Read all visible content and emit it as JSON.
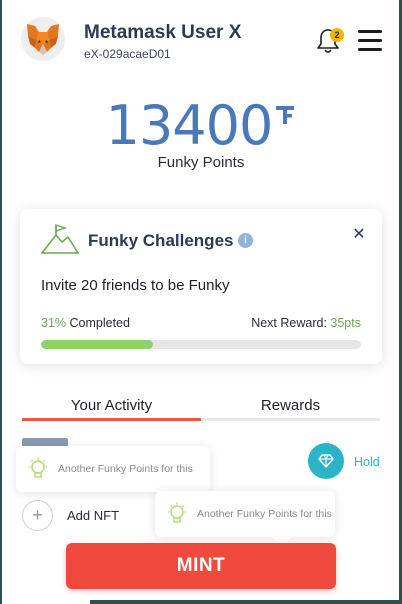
{
  "header": {
    "user_name": "Metamask User X",
    "user_id": "eX-029acaeD01",
    "avatar_icon": "metamask-fox-icon",
    "notification_icon": "bell-icon",
    "notification_count": "2",
    "menu_icon": "hamburger-menu-icon"
  },
  "points": {
    "value": "13400",
    "currency_icon": "funky-points-symbol-icon",
    "label": "Funky Points"
  },
  "challenge": {
    "icon": "mountain-flag-icon",
    "title": "Funky Challenges",
    "info_icon": "info-icon",
    "close_icon": "close-icon",
    "description": "Invite 20 friends to be Funky",
    "progress_value": "31%",
    "progress_suffix": " Completed",
    "progress_fraction": 0.35,
    "next_reward_label": "Next Reward: ",
    "next_reward_value": "35pts"
  },
  "tabs": [
    {
      "label": "Your Activity",
      "active": true
    },
    {
      "label": "Rewards",
      "active": false
    }
  ],
  "activity": {
    "tooltip_1": "Another Funky Points for this",
    "tooltip_2": "Another Funky Points for this",
    "hold_label": "Hold",
    "hold_icon": "diamond-hand-icon",
    "add_label": "Add NFT",
    "add_icon": "plus-icon",
    "tip_icon": "lightbulb-icon"
  },
  "mint_button": "MINT",
  "colors": {
    "accent": "#f04a3e",
    "points_blue": "#4a78b8",
    "progress_green": "#8cd46a",
    "hold_teal": "#2bb3c8",
    "badge_yellow": "#f4b400"
  }
}
